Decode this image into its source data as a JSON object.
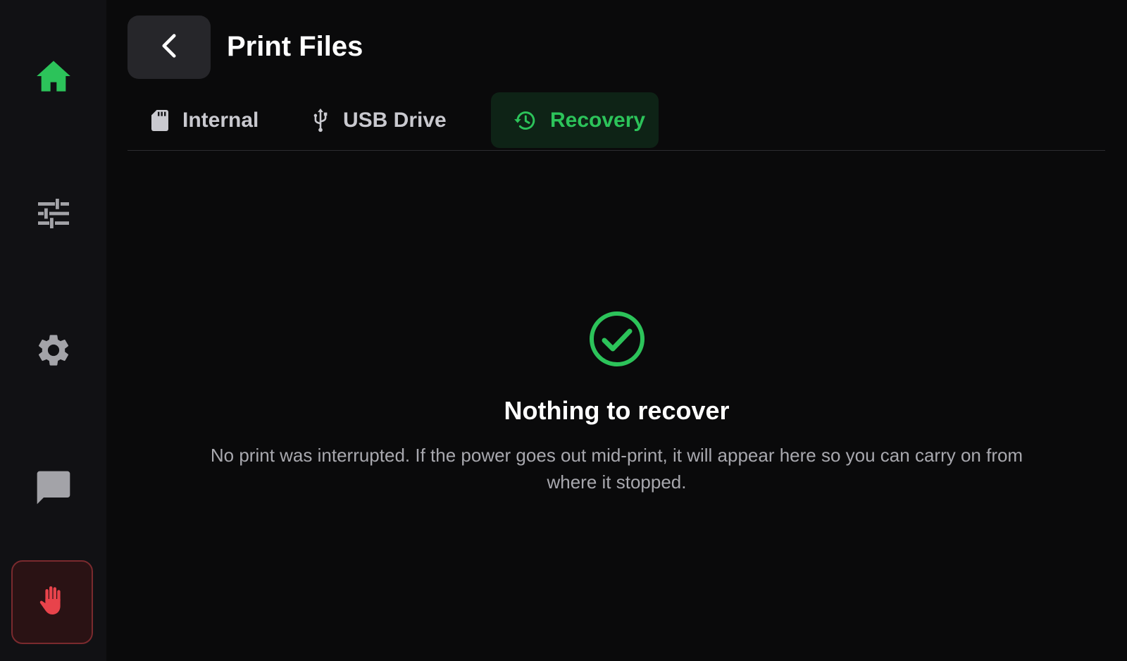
{
  "colors": {
    "accent": "#2cc35a",
    "background": "#0a0a0b",
    "sidebar": "#111114",
    "icon_muted": "#a3a3a8",
    "danger": "#e8434b"
  },
  "sidebar": {
    "items": [
      {
        "name": "home",
        "icon": "home-icon",
        "active": true
      },
      {
        "name": "tune",
        "icon": "sliders-icon",
        "active": false
      },
      {
        "name": "settings",
        "icon": "gear-icon",
        "active": false
      },
      {
        "name": "messages",
        "icon": "chat-icon",
        "active": false
      }
    ],
    "emergency_stop": {
      "icon": "hand-stop-icon"
    }
  },
  "header": {
    "back_icon": "chevron-left-icon",
    "title": "Print Files"
  },
  "tabs": [
    {
      "label": "Internal",
      "icon": "sd-card-icon",
      "active": false
    },
    {
      "label": "USB Drive",
      "icon": "usb-icon",
      "active": false
    },
    {
      "label": "Recovery",
      "icon": "history-icon",
      "active": true
    }
  ],
  "empty_state": {
    "icon": "check-circle-icon",
    "title": "Nothing to recover",
    "description": "No print was interrupted. If the power goes out mid-print, it will appear here so you can carry on from where it stopped."
  }
}
